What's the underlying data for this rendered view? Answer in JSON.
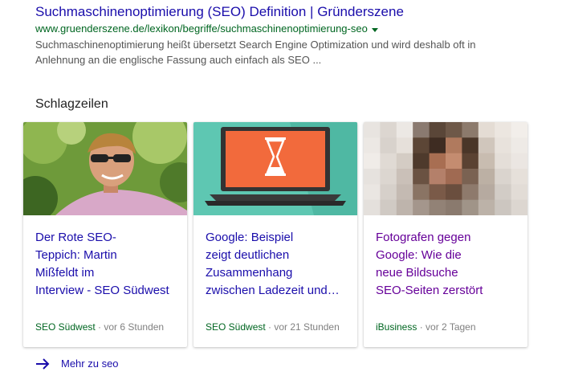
{
  "result": {
    "title": "Suchmaschinenoptimierung (SEO) Definition | Gründerszene",
    "url": "www.gruenderszene.de/lexikon/begriffe/suchmaschinenoptimierung-seo",
    "snippet_lines": [
      "Suchmaschinenoptimierung heißt übersetzt Search Engine Optimization und wird deshalb oft in",
      "Anlehnung an die englische Fassung auch einfach als SEO ..."
    ]
  },
  "headlines": {
    "section_title": "Schlagzeilen",
    "cards": [
      {
        "title_lines": [
          "Der Rote SEO-",
          "Teppich: Martin",
          "Mißfeldt im",
          "Interview - SEO Südwest"
        ],
        "source": "SEO Südwest",
        "separator": " · ",
        "time": "vor 6 Stunden"
      },
      {
        "title_lines": [
          "Google: Beispiel",
          "zeigt deutlichen",
          "Zusammenhang",
          "zwischen Ladezeit und…"
        ],
        "source": "SEO Südwest",
        "separator": " · ",
        "time": "vor 21 Stunden"
      },
      {
        "title_lines": [
          "Fotografen gegen",
          "Google: Wie die",
          "neue Bildsuche",
          "SEO-Seiten zerstört"
        ],
        "source": "iBusiness",
        "separator": " · ",
        "time": "vor 2 Tagen"
      }
    ]
  },
  "more": {
    "label": "Mehr zu seo",
    "icon": "arrow-right-icon"
  },
  "colors": {
    "link": "#1a0dab",
    "visited": "#660099",
    "url": "#006621",
    "snippet": "#545454",
    "meta": "#808080",
    "thumb_teal": "#5ec7b2",
    "thumb_orange": "#f26a3c"
  }
}
